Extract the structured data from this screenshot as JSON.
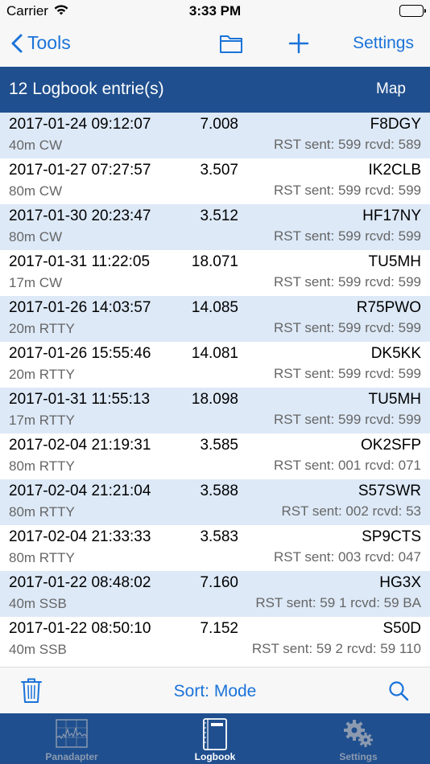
{
  "status_bar": {
    "carrier": "Carrier",
    "time": "3:33 PM",
    "wifi_icon": "wifi-icon",
    "battery_icon": "battery-icon"
  },
  "nav": {
    "back_label": "Tools",
    "folder_icon": "folder-icon",
    "add_icon": "plus-icon",
    "settings_label": "Settings"
  },
  "header": {
    "title": "12 Logbook entrie(s)",
    "map_label": "Map"
  },
  "entries": [
    {
      "datetime": "2017-01-24 09:12:07",
      "freq": "7.008",
      "call": "F8DGY",
      "mode": "40m CW",
      "rst": "RST sent: 599  rcvd: 589"
    },
    {
      "datetime": "2017-01-27 07:27:57",
      "freq": "3.507",
      "call": "IK2CLB",
      "mode": "80m CW",
      "rst": "RST sent: 599  rcvd: 599"
    },
    {
      "datetime": "2017-01-30 20:23:47",
      "freq": "3.512",
      "call": "HF17NY",
      "mode": "80m CW",
      "rst": "RST sent: 599  rcvd: 599"
    },
    {
      "datetime": "2017-01-31 11:22:05",
      "freq": "18.071",
      "call": "TU5MH",
      "mode": "17m CW",
      "rst": "RST sent: 599  rcvd: 599"
    },
    {
      "datetime": "2017-01-26 14:03:57",
      "freq": "14.085",
      "call": "R75PWO",
      "mode": "20m RTTY",
      "rst": "RST sent: 599  rcvd: 599"
    },
    {
      "datetime": "2017-01-26 15:55:46",
      "freq": "14.081",
      "call": "DK5KK",
      "mode": "20m RTTY",
      "rst": "RST sent: 599  rcvd: 599"
    },
    {
      "datetime": "2017-01-31 11:55:13",
      "freq": "18.098",
      "call": "TU5MH",
      "mode": "17m RTTY",
      "rst": "RST sent: 599  rcvd: 599"
    },
    {
      "datetime": "2017-02-04 21:19:31",
      "freq": "3.585",
      "call": "OK2SFP",
      "mode": "80m RTTY",
      "rst": "RST sent: 001  rcvd: 071"
    },
    {
      "datetime": "2017-02-04 21:21:04",
      "freq": "3.588",
      "call": "S57SWR",
      "mode": "80m RTTY",
      "rst": "RST sent: 002  rcvd: 53"
    },
    {
      "datetime": "2017-02-04 21:33:33",
      "freq": "3.583",
      "call": "SP9CTS",
      "mode": "80m RTTY",
      "rst": "RST sent: 003  rcvd: 047"
    },
    {
      "datetime": "2017-01-22 08:48:02",
      "freq": "7.160",
      "call": "HG3X",
      "mode": "40m SSB",
      "rst": "RST sent: 59 1  rcvd: 59 BA"
    },
    {
      "datetime": "2017-01-22 08:50:10",
      "freq": "7.152",
      "call": "S50D",
      "mode": "40m SSB",
      "rst": "RST sent: 59 2  rcvd: 59 110"
    }
  ],
  "toolbar": {
    "trash_icon": "trash-icon",
    "sort_label": "Sort: Mode",
    "search_icon": "search-icon"
  },
  "tabs": [
    {
      "label": "Panadapter",
      "icon": "panadapter-icon",
      "active": false
    },
    {
      "label": "Logbook",
      "icon": "logbook-icon",
      "active": true
    },
    {
      "label": "Settings",
      "icon": "gears-icon",
      "active": false
    }
  ],
  "colors": {
    "accent": "#1a73d9",
    "header_bg": "#1f4f8e",
    "row_alt": "#dde9f7",
    "tab_inactive": "#8c9ab0"
  }
}
